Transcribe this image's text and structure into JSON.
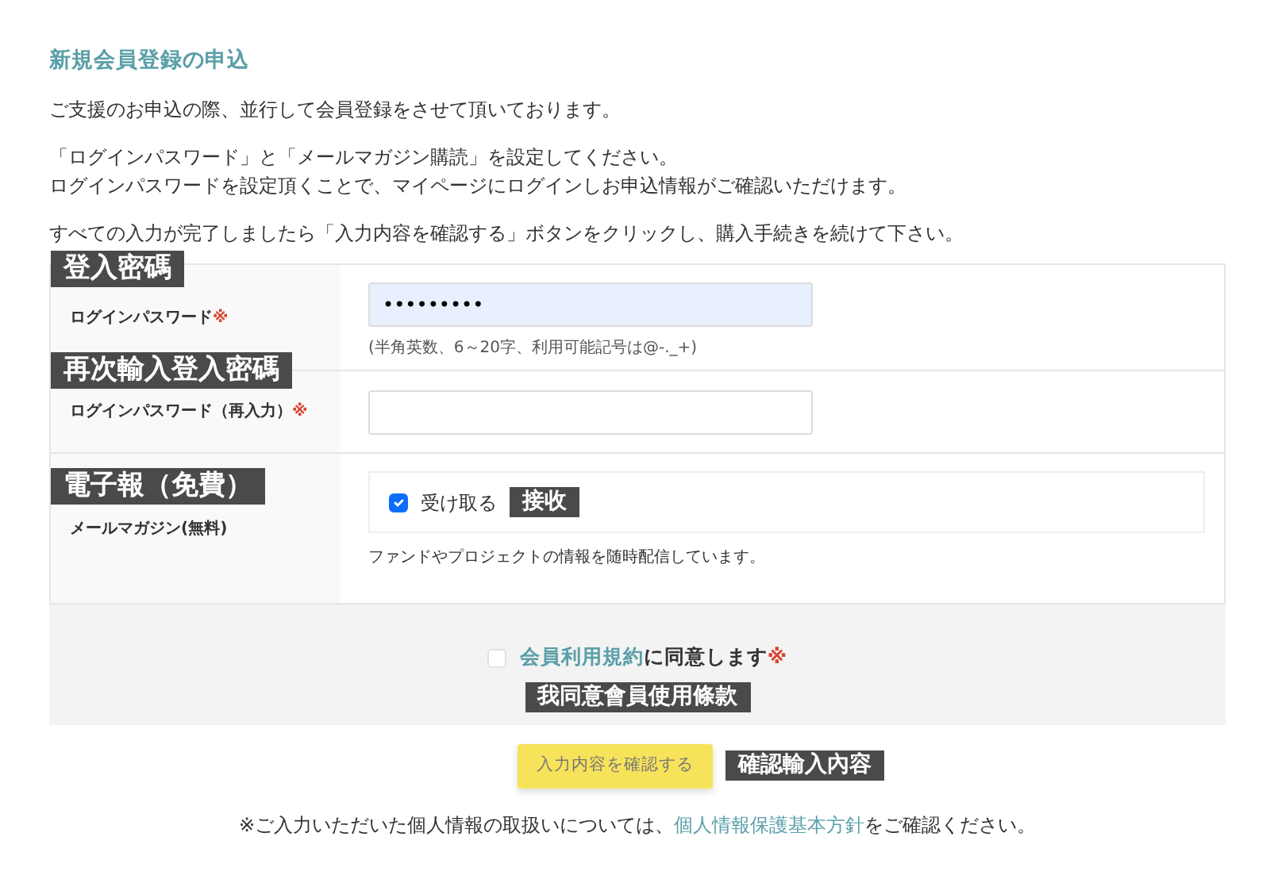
{
  "title": "新規会員登録の申込",
  "intro": [
    "ご支援のお申込の際、並行して会員登録をさせて頂いております。",
    "「ログインパスワード」と「メールマガジン購読」を設定してください。",
    "ログインパスワードを設定頂くことで、マイページにログインしお申込情報がご確認いただけます。",
    "すべての入力が完了しましたら「入力内容を確認する」ボタンをクリックし、購入手続きを続けて下さい。"
  ],
  "fields": [
    {
      "kind": "password",
      "label": "ログインパスワード",
      "required_mark": "※",
      "value": "•••••••••",
      "autofilled": true,
      "hint": "(半角英数、6～20字、利用可能記号は@-._+)",
      "annotation": "登入密碼"
    },
    {
      "kind": "password",
      "label": "ログインパスワード（再入力）",
      "required_mark": "※",
      "autofilled": false,
      "annotation": "再次輸入登入密碼"
    },
    {
      "kind": "checkbox",
      "label": "メールマガジン(無料)",
      "option": {
        "label": "受け取る",
        "checked": true,
        "annotation": "接收"
      },
      "note": "ファンドやプロジェクトの情報を随時配信しています。",
      "annotation": "電子報（免費）"
    }
  ],
  "agree": {
    "checked": false,
    "link": "会員利用規約",
    "text": "に同意します",
    "required_mark": "※",
    "annotation": "我同意會員使用條款"
  },
  "submit": {
    "label": "入力内容を確認する",
    "annotation": "確認輸入內容"
  },
  "footer": {
    "before": "※ご入力いただいた個人情報の取扱いについては、",
    "link": "個人情報保護基本方針",
    "after": "をご確認ください。"
  }
}
